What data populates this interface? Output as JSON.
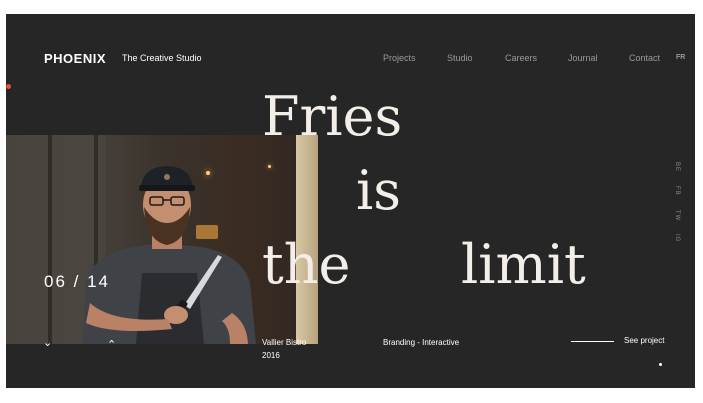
{
  "header": {
    "logo": "PHOENIX",
    "tagline": "The Creative Studio"
  },
  "nav": {
    "items": [
      "Projects",
      "Studio",
      "Careers",
      "Journal",
      "Contact"
    ],
    "lang": "FR"
  },
  "headline": {
    "word1": "Fries",
    "word2": "is",
    "word3": "the",
    "word4": "limit"
  },
  "slider": {
    "counter": "06 / 14"
  },
  "social": [
    "BE",
    "FB",
    "TW",
    "IG"
  ],
  "project": {
    "client": "Vallier Bistro",
    "year": "2016",
    "category": "Branding - Interactive",
    "cta": "See project"
  },
  "colors": {
    "background": "#262626",
    "accent": "#e5533c",
    "text": "#ffffff"
  }
}
